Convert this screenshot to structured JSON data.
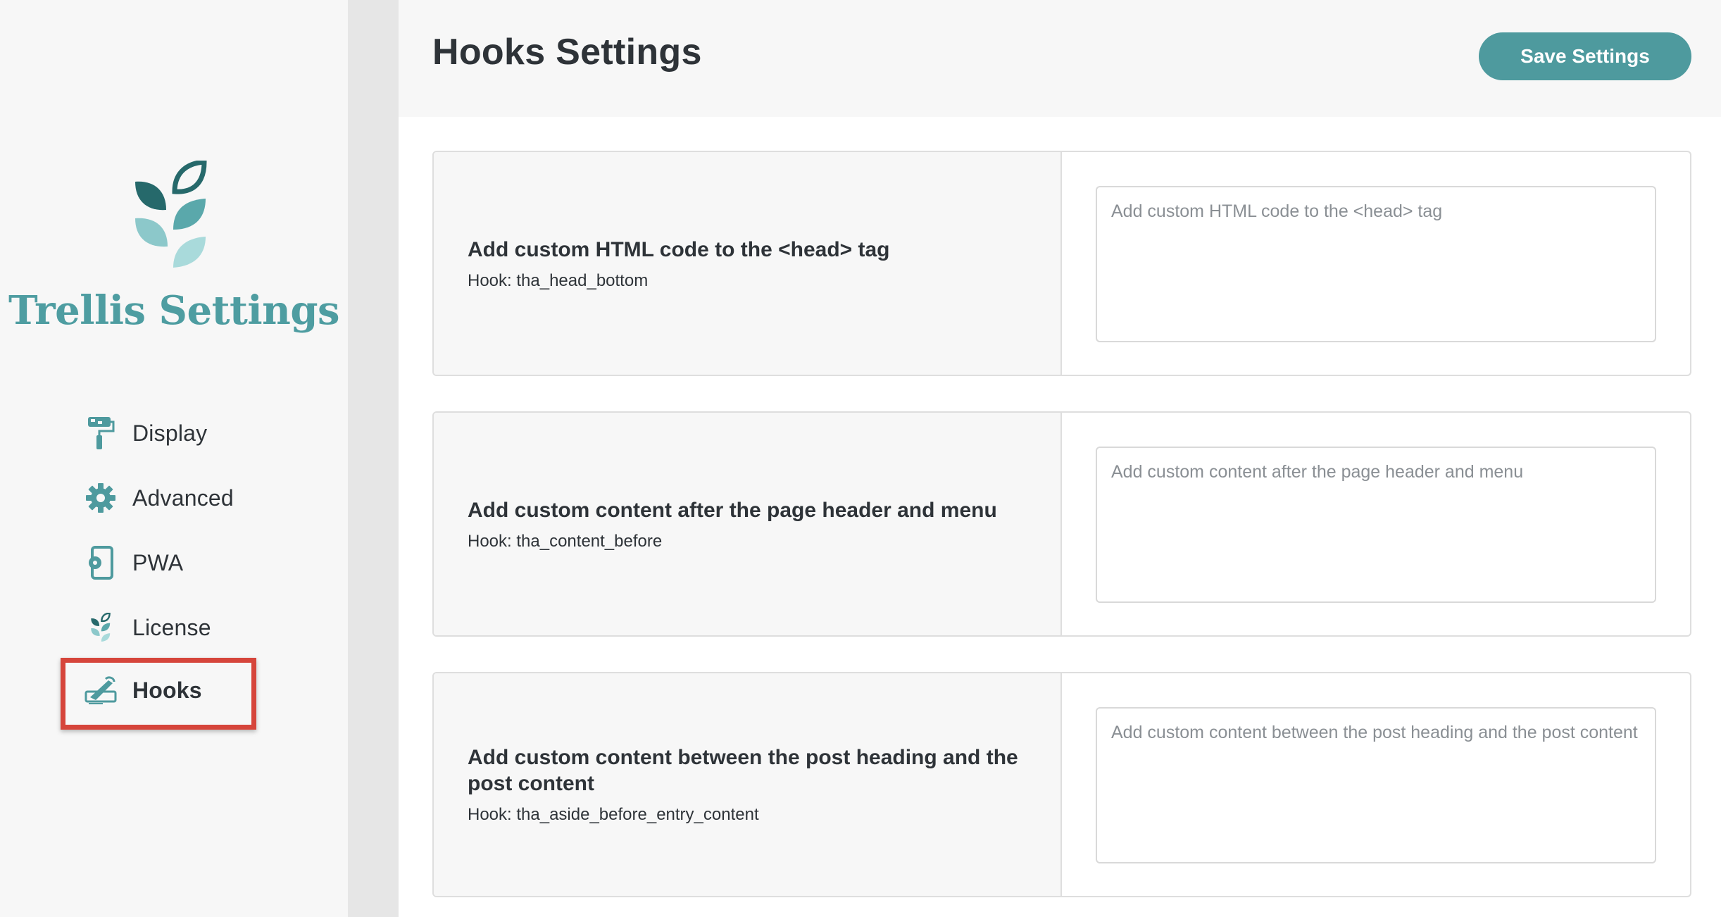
{
  "sidebar": {
    "brand": "Trellis Settings",
    "items": [
      {
        "label": "Display",
        "icon": "paint-roller-icon"
      },
      {
        "label": "Advanced",
        "icon": "gear-icon"
      },
      {
        "label": "PWA",
        "icon": "mobile-gear-icon"
      },
      {
        "label": "License",
        "icon": "leaf-logo-icon"
      },
      {
        "label": "Hooks",
        "icon": "hook-icon",
        "active": true
      }
    ]
  },
  "header": {
    "title": "Hooks Settings",
    "save_label": "Save Settings"
  },
  "hooks": [
    {
      "title": "Add custom HTML code to the <head> tag",
      "hook": "Hook: tha_head_bottom",
      "placeholder": "Add custom HTML code to the <head> tag",
      "value": ""
    },
    {
      "title": "Add custom content after the page header and menu",
      "hook": "Hook: tha_content_before",
      "placeholder": "Add custom content after the page header and menu",
      "value": ""
    },
    {
      "title": "Add custom content between the post heading and the post content",
      "hook": "Hook: tha_aside_before_entry_content",
      "placeholder": "Add custom content between the post heading and the post content",
      "value": ""
    }
  ],
  "colors": {
    "accent": "#4e9a9e",
    "brand_text": "#4e9da1",
    "highlight": "#d6453b",
    "leaf_dark": "#26696b",
    "leaf_mid": "#5aa8ab",
    "leaf_light": "#8cc8ca",
    "leaf_pale": "#a9dadb"
  }
}
